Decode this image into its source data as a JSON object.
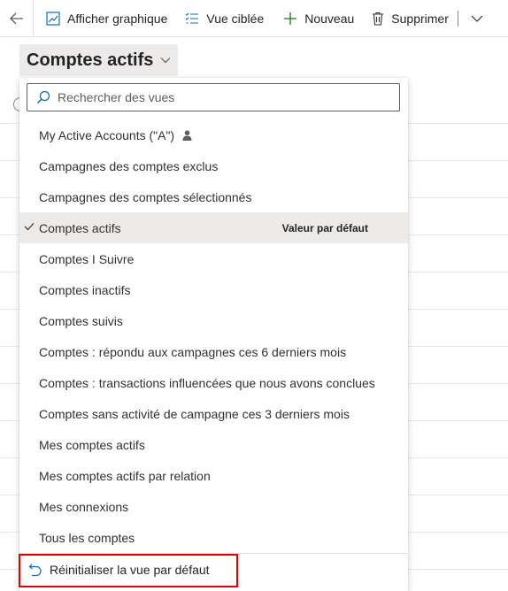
{
  "command_bar": {
    "show_chart": "Afficher graphique",
    "focused_view": "Vue ciblée",
    "new": "Nouveau",
    "delete": "Supprimer"
  },
  "view_selector": {
    "title": "Comptes actifs"
  },
  "dropdown": {
    "search_placeholder": "Rechercher des vues",
    "items": [
      {
        "label": "My Active Accounts (\"A\")"
      },
      {
        "label": "Campagnes des comptes exclus"
      },
      {
        "label": "Campagnes des comptes sélectionnés"
      },
      {
        "label": "Comptes actifs",
        "default_tag": "Valeur par défaut"
      },
      {
        "label": "Comptes I Suivre"
      },
      {
        "label": "Comptes inactifs"
      },
      {
        "label": "Comptes suivis"
      },
      {
        "label": "Comptes : répondu aux campagnes ces 6 derniers mois"
      },
      {
        "label": "Comptes : transactions influencées que nous avons conclues"
      },
      {
        "label": "Comptes sans activité de campagne ces 3 derniers mois"
      },
      {
        "label": "Mes comptes actifs"
      },
      {
        "label": "Mes comptes actifs par relation"
      },
      {
        "label": "Mes connexions"
      },
      {
        "label": "Tous les comptes"
      }
    ],
    "reset_label": "Réinitialiser la vue par défaut"
  },
  "colors": {
    "accent": "#0f6cbd",
    "highlight_box": "#e00000",
    "selected_bg": "#edebe9"
  },
  "icons": {
    "back": "arrow-left-icon",
    "chart": "chart-icon",
    "focused": "list-icon",
    "new": "plus-icon",
    "delete": "trash-icon",
    "overflow": "chevron-down-icon",
    "search": "search-icon",
    "check": "checkmark-icon",
    "person": "person-icon",
    "reset": "undo-icon"
  }
}
